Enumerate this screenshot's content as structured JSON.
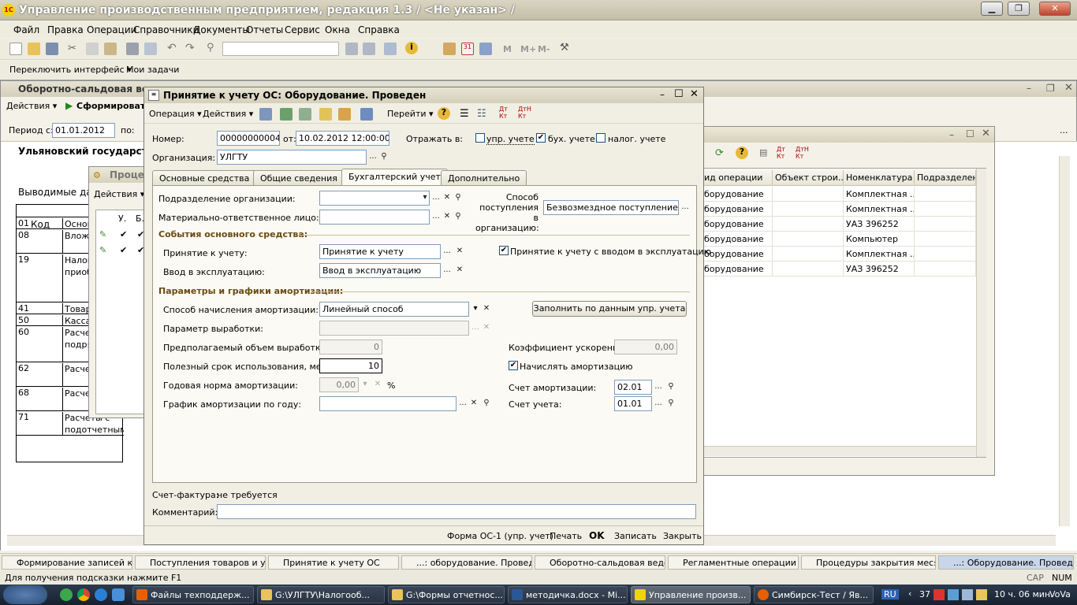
{
  "app": {
    "title": "Управление производственным предприятием, редакция 1.3 / <Не указан> /",
    "logo": "1С"
  },
  "menu": [
    "Файл",
    "Правка",
    "Операции",
    "Справочники",
    "Документы",
    "Отчеты",
    "Сервис",
    "Окна",
    "Справка"
  ],
  "toolbar2": {
    "switch_interface": "Переключить интерфейс ▾",
    "my_tasks": "Мои задачи"
  },
  "bg_report": {
    "title": "Оборотно-сальдовая ведо...",
    "actions": "Действия ▾",
    "form_button": "Сформировать",
    "period_label": "Период с:",
    "period_from": "01.01.2012",
    "period_to_label": "по:",
    "org_heading": "Ульяновский государствен",
    "output_label": "Выводимые дан",
    "code_header": "Код",
    "rows": [
      {
        "code": "01",
        "name": "Основ"
      },
      {
        "code": "08",
        "name": "Влож внеоб"
      },
      {
        "code": "19",
        "name": "Налог стоим приоб ценно"
      },
      {
        "code": "41",
        "name": "Товар"
      },
      {
        "code": "50",
        "name": "Касса"
      },
      {
        "code": "60",
        "name": "Расче поста подря"
      },
      {
        "code": "62",
        "name": "Расче и зака"
      },
      {
        "code": "68",
        "name": "Расче сборa"
      },
      {
        "code": "71",
        "name": "Расчеты с подотчетным"
      }
    ]
  },
  "proc_window": {
    "title": "Процед",
    "actions": "Действия ▾",
    "col1": "У.",
    "col2": "Б."
  },
  "right_window": {
    "columns": [
      "ид операции",
      "Объект строи...",
      "Номенклатура",
      "Подразделен..."
    ],
    "rows": [
      [
        "борудование",
        "",
        "Комплектная ...",
        ""
      ],
      [
        "борудование",
        "",
        "Комплектная ...",
        ""
      ],
      [
        "борудование",
        "",
        "УАЗ 396252",
        ""
      ],
      [
        "борудование",
        "",
        "Компьютер",
        ""
      ],
      [
        "борудование",
        "",
        "Комплектная ...",
        ""
      ],
      [
        "борудование",
        "",
        "УАЗ 396252",
        ""
      ]
    ]
  },
  "doc": {
    "title": "Принятие к учету ОС: Оборудование. Проведен",
    "toolbar": {
      "operation": "Операция ▾",
      "actions": "Действия ▾",
      "goto": "Перейти ▾"
    },
    "number_label": "Номер:",
    "number": "00000000004",
    "date_label": "от:",
    "date": "10.02.2012 12:00:00",
    "reflect_label": "Отражать в:",
    "chk_upr": "упр. учете",
    "chk_buh": "бух. учете",
    "chk_nal": "налог. учете",
    "org_label": "Организация:",
    "org": "УЛГТУ",
    "tabs": [
      "Основные средства",
      "Общие сведения",
      "Бухгалтерский учет",
      "Дополнительно"
    ],
    "subdiv_label": "Подразделение организации:",
    "mol_label": "Материально-ответственное лицо:",
    "receipt_label": "Способ поступления в организацию:",
    "receipt_value": "Безвозмездное поступление",
    "events_group": "События основного средства:",
    "accept_label": "Принятие к учету:",
    "accept_value": "Принятие к учету",
    "commission_label": "Ввод в эксплуатацию:",
    "commission_value": "Ввод в эксплуатацию",
    "accept_with_commission": "Принятие к учету с вводом в эксплуатацию",
    "amort_group": "Параметры и графики амортизации:",
    "method_label": "Способ начисления амортизации:",
    "method_value": "Линейный способ",
    "fill_button": "Заполнить по данным упр. учета",
    "output_param_label": "Параметр выработки:",
    "volume_label": "Предполагаемый объем выработки:",
    "volume_value": "0",
    "accel_label": "Коэффициент ускорения:",
    "accel_value": "0,00",
    "life_label": "Полезный срок использования, мес.:",
    "life_value": "10",
    "accrue_label": "Начислять амортизацию",
    "annual_rate_label": "Годовая норма амортизации:",
    "annual_rate_value": "0,00",
    "percent": "%",
    "amort_account_label": "Счет амортизации:",
    "amort_account": "02.01",
    "schedule_label": "График амортизации по году:",
    "account_label": "Счет учета:",
    "account": "01.01",
    "invoice_label": "Счет-фактура:",
    "invoice_value": "не требуется",
    "comment_label": "Комментарий:",
    "footer": {
      "form": "Форма ОС-1 (упр. учет)",
      "print": "Печать",
      "ok": "OK",
      "save": "Записать",
      "close": "Закрыть"
    }
  },
  "window_tabs": [
    "Формирование записей к...",
    "Поступления товаров и ус...",
    "Принятие к учету ОС",
    "...: оборудование. Проведен",
    "Оборотно-сальдовая ведо...",
    "Регламентные операции",
    "Процедуры закрытия меся...",
    "...: Оборудование. Проведен"
  ],
  "status": {
    "hint": "Для получения подсказки нажмите F1",
    "cap": "CAP",
    "num": "NUM"
  },
  "taskbar": {
    "items": [
      "Файлы техподдерж...",
      "G:\\УЛГТУ\\Налогооб...",
      "G:\\Формы отчетнос...",
      "методичка.docx - Mi...",
      "Управление произв...",
      "Симбирск-Тест / Яв..."
    ],
    "lang": "RU",
    "tray_count": "37",
    "clock": "10 ч. 06 мин.",
    "user": "VoVa"
  },
  "colors": {
    "accent": "#316ac5",
    "group": "#6b4a12"
  }
}
